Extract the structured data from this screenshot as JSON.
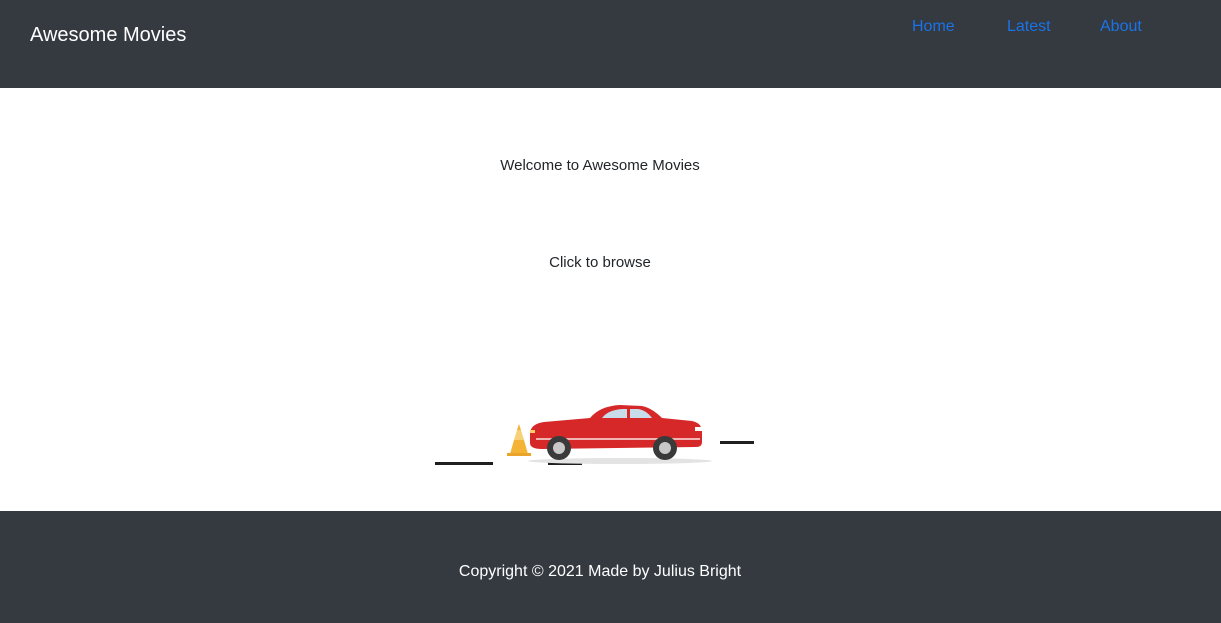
{
  "header": {
    "brand": "Awesome Movies",
    "nav": [
      {
        "label": "Home"
      },
      {
        "label": "Latest"
      },
      {
        "label": "About"
      }
    ]
  },
  "main": {
    "welcome_text": "Welcome to Awesome Movies",
    "browse_text": "Click to browse",
    "illustration": "red-car-with-traffic-cone"
  },
  "footer": {
    "copyright": "Copyright © 2021 Made by Julius Bright"
  },
  "colors": {
    "header_bg": "#343a40",
    "footer_bg": "#343a40",
    "nav_link": "#1a73e8",
    "car_body": "#d62828"
  }
}
